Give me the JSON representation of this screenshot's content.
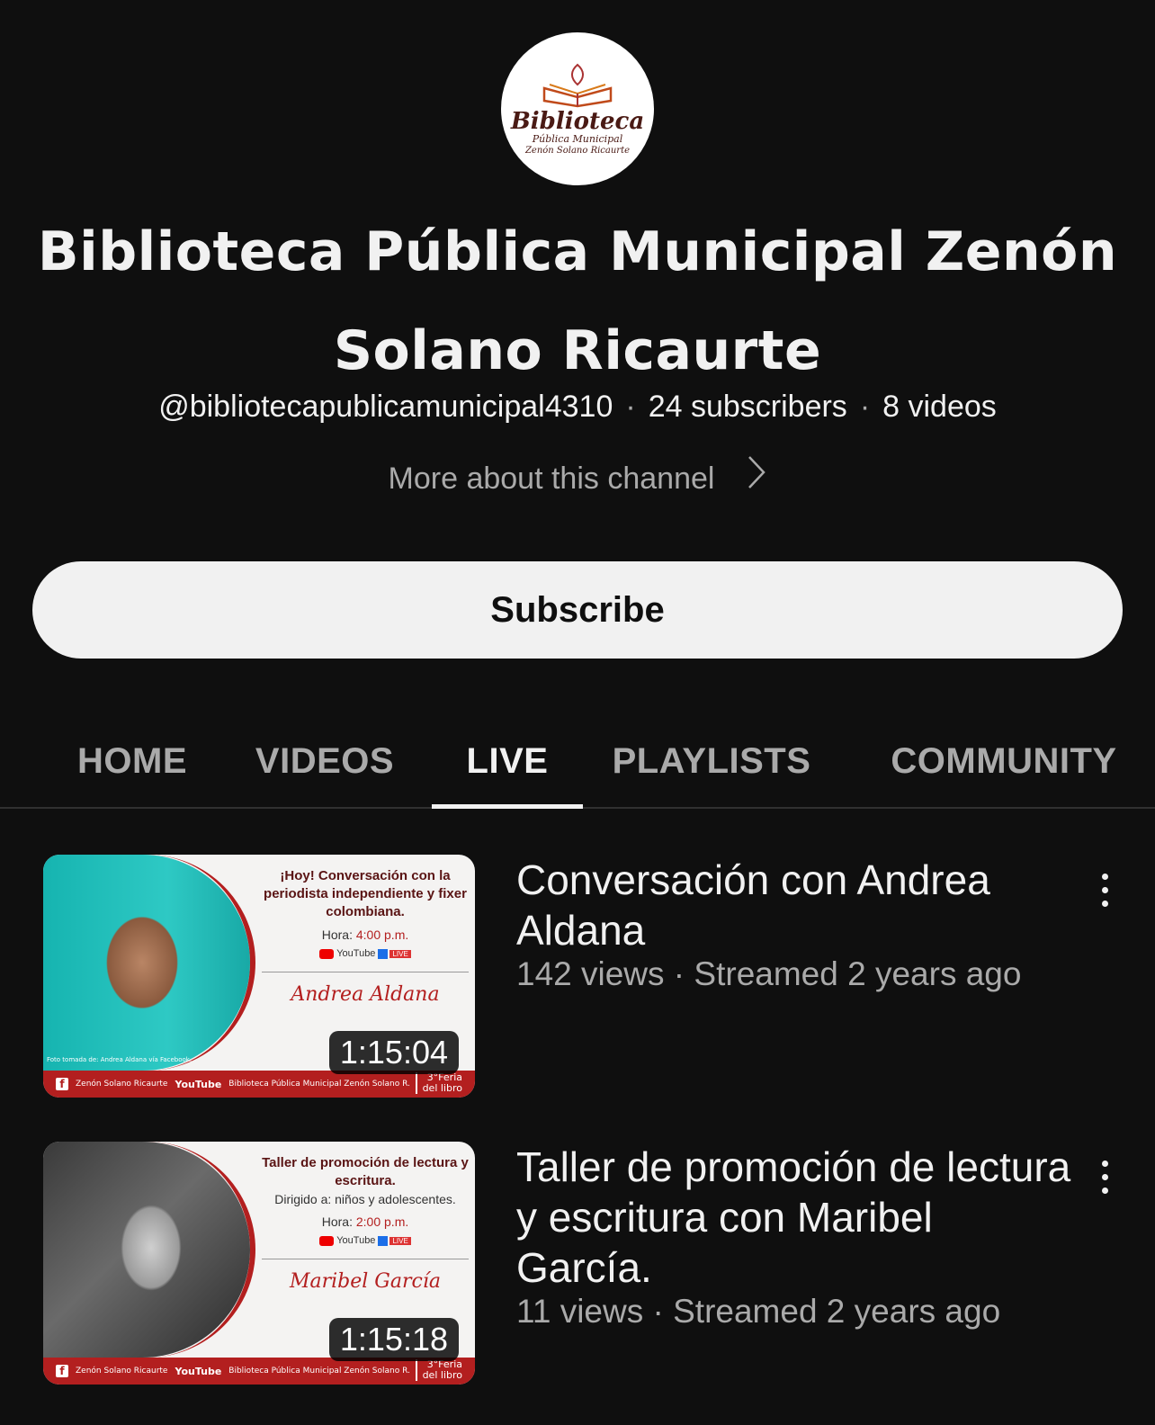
{
  "channel": {
    "avatar_text": {
      "line1": "Biblioteca",
      "line2": "Pública Municipal",
      "line3": "Zenón Solano Ricaurte"
    },
    "title": "Biblioteca Pública Municipal Zenón Solano Ricaurte",
    "handle": "@bibliotecapublicamunicipal4310",
    "subscribers": "24 subscribers",
    "videos_count": "8 videos",
    "more_about": "More about this channel",
    "subscribe_label": "Subscribe"
  },
  "tabs": [
    {
      "label": "HOME",
      "active": false
    },
    {
      "label": "VIDEOS",
      "active": false
    },
    {
      "label": "LIVE",
      "active": true
    },
    {
      "label": "PLAYLISTS",
      "active": false
    },
    {
      "label": "COMMUNITY",
      "active": false
    }
  ],
  "videos": [
    {
      "title": "Conversación con Andrea Aldana",
      "views": "142 views",
      "streamed": "Streamed 2 years ago",
      "duration": "1:15:04",
      "thumbnail": {
        "headline": "¡Hoy! Conversación con la periodista independiente y fixer colombiana.",
        "detail": "",
        "time_label": "Hora:",
        "time": "4:00 p.m.",
        "name": "Andrea Aldana",
        "credit": "Foto tomada de: Andrea Aldana vía Facebook.",
        "band_fb": "Zenón Solano Ricaurte",
        "band_yt": "YouTube",
        "band_org": "Biblioteca Pública Municipal Zenón Solano R.",
        "feria_1": "3°Feria",
        "feria_2": "del libro"
      }
    },
    {
      "title": "Taller de promoción de lectura y escritura con Maribel García.",
      "views": "11 views",
      "streamed": "Streamed 2 years ago",
      "duration": "1:15:18",
      "thumbnail": {
        "headline": "Taller de promoción de lectura y escritura.",
        "detail": "Dirigido a: niños y adolescentes.",
        "time_label": "Hora:",
        "time": "2:00 p.m.",
        "name": "Maribel García",
        "credit": "",
        "band_fb": "Zenón Solano Ricaurte",
        "band_yt": "YouTube",
        "band_org": "Biblioteca Pública Municipal Zenón Solano R.",
        "feria_1": "3°Feria",
        "feria_2": "del libro"
      }
    }
  ],
  "colors": {
    "background": "#0f0f0f",
    "text": "#f1f1f1",
    "secondary": "#aaaaaa",
    "brand_red": "#b31f1f"
  }
}
